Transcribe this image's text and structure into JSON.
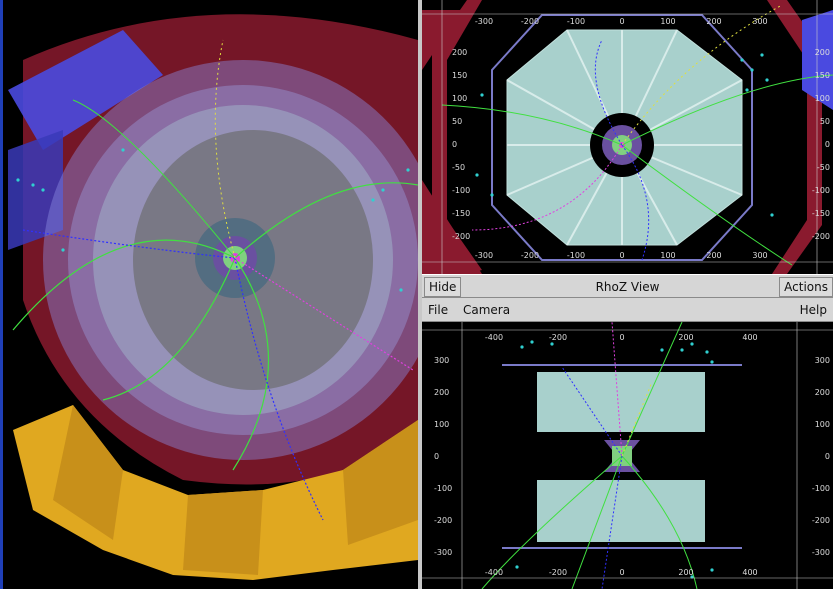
{
  "rphi_view": {
    "x_ticks": [
      "-300",
      "-200",
      "-100",
      "0",
      "100",
      "200",
      "300"
    ],
    "y_ticks_left": [
      "200",
      "150",
      "100",
      "50",
      "0",
      "-50",
      "-100",
      "-150",
      "-200"
    ],
    "y_ticks_right": [
      "200",
      "150",
      "100",
      "50",
      "0",
      "-50",
      "-100",
      "-150",
      "-200"
    ]
  },
  "rhoz_view": {
    "title": "RhoZ View",
    "hide_label": "Hide",
    "actions_label": "Actions",
    "menu": {
      "file": "File",
      "camera": "Camera",
      "help": "Help"
    },
    "x_ticks": [
      "-400",
      "-200",
      "0",
      "200",
      "400"
    ],
    "y_ticks_left": [
      "300",
      "200",
      "100",
      "0",
      "-100",
      "-200",
      "-300"
    ],
    "y_ticks_right": [
      "300",
      "200",
      "100",
      "0",
      "-100",
      "-200",
      "-300"
    ]
  },
  "colors": {
    "calorimeter": "#a8d0cc",
    "muon_red": "#8a1a2e",
    "muon_blue": "#4a4ae0",
    "endcap_yellow": "#e0a820",
    "track_green": "#40e040",
    "track_blue": "#3030ff",
    "track_magenta": "#e040e0",
    "hits_cyan": "#30d0d0"
  }
}
